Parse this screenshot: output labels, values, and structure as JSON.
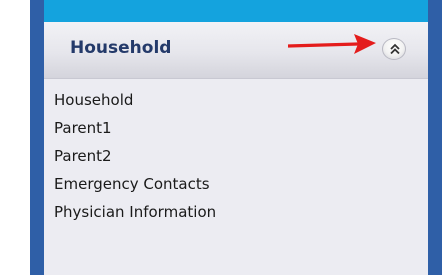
{
  "panel": {
    "title": "Household",
    "collapse_icon": "double-chevron-up-icon",
    "annotation_icon": "red-arrow-icon",
    "colors": {
      "frame": "#2f5fa7",
      "top_strip": "#14a3de",
      "title_text": "#243a6a",
      "arrow": "#e41c1c"
    }
  },
  "nav": {
    "items": [
      {
        "label": "Household"
      },
      {
        "label": "Parent1"
      },
      {
        "label": "Parent2"
      },
      {
        "label": "Emergency Contacts"
      },
      {
        "label": "Physician Information"
      }
    ]
  }
}
